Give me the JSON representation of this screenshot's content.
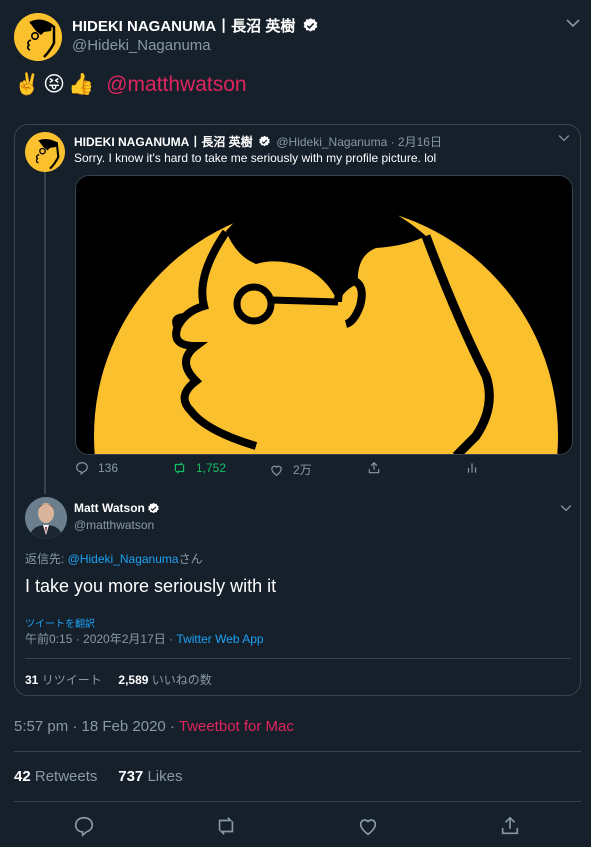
{
  "author": {
    "name": "HIDEKI NAGANUMA丨長沼 英樹",
    "handle": "@Hideki_Naganuma"
  },
  "tweet": {
    "emojis": [
      "✌️",
      "😝",
      "👍"
    ],
    "mention": "@matthwatson"
  },
  "quoted": {
    "name": "HIDEKI NAGANUMA丨長沼 英樹",
    "handle_date": "@Hideki_Naganuma · 2月16日",
    "text": "Sorry. I know it's hard to take me seriously with my profile picture. lol",
    "actions": {
      "replies": "136",
      "retweets": "1,752",
      "likes": "2万"
    }
  },
  "reply": {
    "name": "Matt Watson",
    "handle": "@matthwatson",
    "reply_prefix": "返信先: ",
    "reply_mention": "@Hideki_Naganuma",
    "reply_suffix": "さん",
    "text": "I take you more seriously with it",
    "translate": "ツイートを翻訳",
    "timestamp": "午前0:15 · 2020年2月17日 · ",
    "app": "Twitter Web App",
    "retweets_count": "31",
    "retweets_label": "リツイート",
    "likes_count": "2,589",
    "likes_label": "いいねの数"
  },
  "meta": {
    "time": "5:57 pm · 18 Feb 2020 · ",
    "client": "Tweetbot for Mac",
    "retweets_count": "42",
    "retweets_label": "Retweets",
    "likes_count": "737",
    "likes_label": "Likes"
  },
  "colors": {
    "background": "#15202b",
    "accent_pink": "#e0245e",
    "link_blue": "#1da1f2",
    "muted": "#8899a6",
    "retweet_green": "#17bf63",
    "avatar_yellow": "#fbc02d"
  },
  "icons": [
    "verified-badge-icon",
    "chevron-down-icon",
    "reply-icon",
    "retweet-icon",
    "like-icon",
    "share-icon",
    "analytics-icon"
  ]
}
